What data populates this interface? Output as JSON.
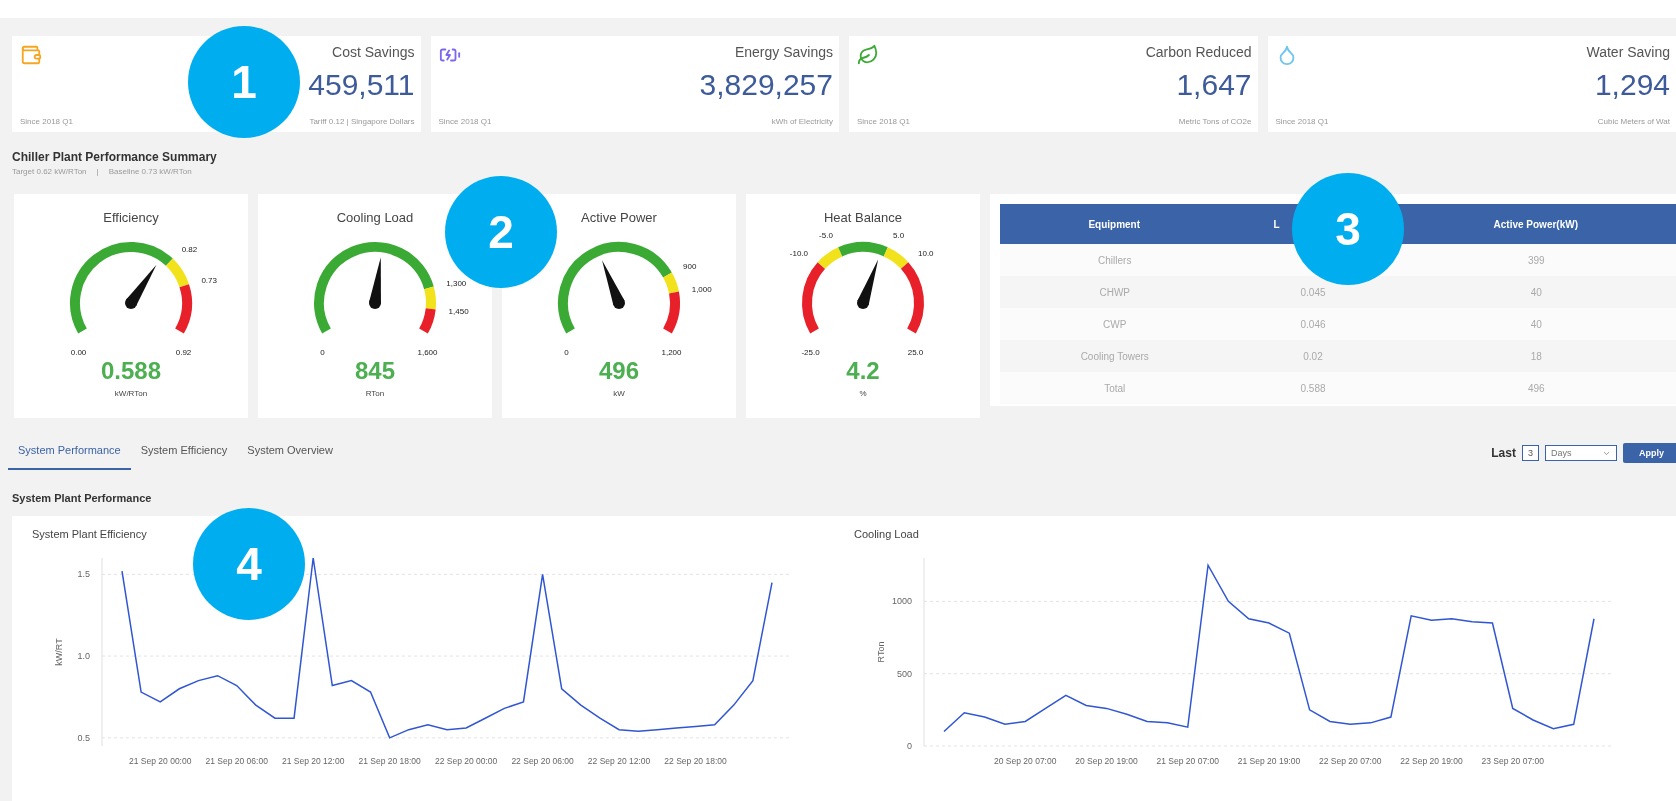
{
  "callouts": [
    "1",
    "2",
    "3",
    "4"
  ],
  "kpis": [
    {
      "kind": "cost",
      "title": "Cost Savings",
      "value": "459,511",
      "since": "Since 2018 Q1",
      "unit": "Tariff 0.12 | Singapore Dollars"
    },
    {
      "kind": "energy",
      "title": "Energy Savings",
      "value": "3,829,257",
      "since": "Since 2018 Q1",
      "unit": "kWh of Electricity"
    },
    {
      "kind": "carbon",
      "title": "Carbon Reduced",
      "value": "1,647",
      "since": "Since 2018 Q1",
      "unit": "Metric Tons of CO2e"
    },
    {
      "kind": "water",
      "title": "Water Saving",
      "value": "1,294",
      "since": "Since 2018 Q1",
      "unit": "Cubic Meters of Wat"
    }
  ],
  "summary": {
    "title": "Chiller Plant Performance Summary",
    "target": "Target 0.62 kW/RTon",
    "separator": "|",
    "baseline": "Baseline 0.73 kW/RTon"
  },
  "gauges": [
    {
      "title": "Efficiency",
      "min_label": "0.00",
      "value": "0.588",
      "unit": "kW/RTon",
      "bands": [
        {
          "color": "#3aaa35",
          "label": "0.82"
        },
        {
          "color": "#f2e21b",
          "label": "0.73"
        },
        {
          "color": "#e8202a",
          "label": "0.92"
        }
      ]
    },
    {
      "title": "Cooling Load",
      "min_label": "0",
      "value": "845",
      "unit": "RTon",
      "bands": [
        {
          "color": "#3aaa35",
          "label": "1,300"
        },
        {
          "color": "#f2e21b",
          "label": "1,450"
        },
        {
          "color": "#e8202a",
          "label": "1,600"
        }
      ]
    },
    {
      "title": "Active Power",
      "min_label": "0",
      "value": "496",
      "unit": "kW",
      "bands": [
        {
          "color": "#3aaa35",
          "label": "900"
        },
        {
          "color": "#f2e21b",
          "label": "1,000"
        },
        {
          "color": "#e8202a",
          "label": "1,200"
        }
      ]
    },
    {
      "title": "Heat Balance",
      "min_label": "-25.0",
      "value": "4.2",
      "unit": "%",
      "bands": [
        {
          "color": "#e8202a",
          "label": "-10.0"
        },
        {
          "color": "#f2e21b",
          "label": "-5.0"
        },
        {
          "color": "#3aaa35",
          "label": "5.0"
        },
        {
          "color": "#f2e21b",
          "label": "10.0"
        },
        {
          "color": "#e8202a",
          "label": "25.0"
        }
      ]
    }
  ],
  "equipment_table": {
    "columns": [
      "Equipment",
      "L",
      "Active Power(kW)"
    ],
    "rows": [
      {
        "equipment": "Chillers",
        "active_power": "399"
      },
      {
        "equipment": "CHWP",
        "column_2": "0.045",
        "active_power": "40"
      },
      {
        "equipment": "CWP",
        "column_2": "0.046",
        "active_power": "40"
      },
      {
        "equipment": "Cooling Towers",
        "column_2": "0.02",
        "active_power": "18"
      },
      {
        "equipment": "Total",
        "column_2": "0.588",
        "active_power": "496"
      }
    ]
  },
  "tabs": [
    {
      "label": "System Performance",
      "selected": true
    },
    {
      "label": "System Efficiency",
      "selected": false
    },
    {
      "label": "System Overview",
      "selected": false
    }
  ],
  "filter": {
    "label": "Last",
    "count": "3",
    "unit": "Days",
    "apply": "Apply"
  },
  "section_title": "System Plant Performance",
  "charts": [
    {
      "title": "System Plant Efficiency",
      "chart_data": {
        "type": "line",
        "ylabel": "kW/RT",
        "categories": [
          null,
          null,
          "21 Sep 20 00:00",
          null,
          null,
          null,
          "21 Sep 20 06:00",
          null,
          null,
          null,
          "21 Sep 20 12:00",
          null,
          null,
          null,
          "21 Sep 20 18:00",
          null,
          null,
          null,
          "22 Sep 20 00:00",
          null,
          null,
          null,
          "22 Sep 20 06:00",
          null,
          null,
          null,
          "22 Sep 20 12:00",
          null,
          null,
          null,
          "22 Sep 20 18:00",
          null,
          null,
          null,
          null
        ],
        "grid": true,
        "ylim": [
          0.45,
          1.6
        ],
        "yticks": [
          {
            "value": 0.5,
            "label": "0.5"
          },
          {
            "value": 1,
            "label": "1.0"
          },
          {
            "value": 1.5,
            "label": "1.5"
          }
        ],
        "series": [
          {
            "color": "#3056d3",
            "values": [
              1.52,
              0.78,
              0.72,
              0.8,
              0.85,
              0.88,
              0.82,
              0.7,
              0.62,
              0.62,
              1.6,
              0.82,
              0.85,
              0.78,
              0.5,
              0.55,
              0.58,
              0.55,
              0.56,
              0.62,
              0.68,
              0.72,
              1.5,
              0.8,
              0.7,
              0.62,
              0.55,
              0.54,
              0.55,
              0.56,
              0.57,
              0.58,
              0.7,
              0.85,
              1.45
            ]
          }
        ]
      }
    },
    {
      "title": "Cooling Load",
      "chart_data": {
        "type": "line",
        "ylabel": "RTon",
        "categories": [
          null,
          null,
          null,
          null,
          "20 Sep 20 07:00",
          null,
          null,
          null,
          "20 Sep 20 19:00",
          null,
          null,
          null,
          "21 Sep 20 07:00",
          null,
          null,
          null,
          "21 Sep 20 19:00",
          null,
          null,
          null,
          "22 Sep 20 07:00",
          null,
          null,
          null,
          "22 Sep 20 19:00",
          null,
          null,
          null,
          "23 Sep 20 07:00",
          null,
          null,
          null,
          null
        ],
        "grid": true,
        "ylim": [
          0,
          1300
        ],
        "yticks": [
          {
            "value": 0,
            "label": "0"
          },
          {
            "value": 500,
            "label": "500"
          },
          {
            "value": 1000,
            "label": "1000"
          }
        ],
        "series": [
          {
            "color": "#3056d3",
            "values": [
              100,
              230,
              200,
              150,
              170,
              260,
              350,
              280,
              260,
              220,
              170,
              160,
              130,
              1250,
              1000,
              880,
              850,
              780,
              250,
              170,
              150,
              160,
              200,
              900,
              870,
              880,
              860,
              850,
              260,
              180,
              120,
              150,
              880
            ]
          }
        ]
      }
    }
  ]
}
